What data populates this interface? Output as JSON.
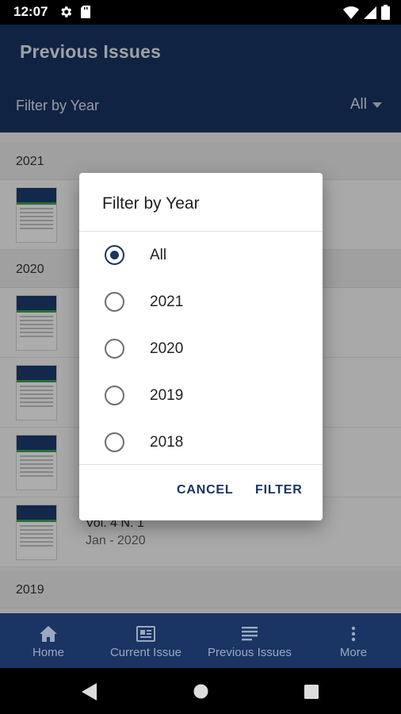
{
  "status_bar": {
    "time": "12:07",
    "left_icons": [
      "gear-icon",
      "sd-card-icon"
    ],
    "right_icons": [
      "wifi-icon",
      "cell-signal-icon",
      "battery-icon"
    ]
  },
  "app_bar": {
    "title": "Previous Issues",
    "filter_label": "Filter by Year",
    "filter_value": "All"
  },
  "sections": [
    {
      "year": "2021",
      "issues": [
        {
          "vol": "",
          "date": ""
        }
      ]
    },
    {
      "year": "2020",
      "issues": [
        {
          "vol": "",
          "date": ""
        },
        {
          "vol": "",
          "date": ""
        },
        {
          "vol": "",
          "date": ""
        },
        {
          "vol": "Vol. 4 N. 1",
          "date": "Jan - 2020"
        }
      ]
    },
    {
      "year": "2019",
      "issues": []
    }
  ],
  "dialog": {
    "title": "Filter by Year",
    "options": [
      {
        "label": "All",
        "selected": true
      },
      {
        "label": "2021",
        "selected": false
      },
      {
        "label": "2020",
        "selected": false
      },
      {
        "label": "2019",
        "selected": false
      },
      {
        "label": "2018",
        "selected": false
      }
    ],
    "cancel_label": "CANCEL",
    "filter_label": "FILTER"
  },
  "bottom_nav": [
    {
      "label": "Home",
      "icon": "home-icon"
    },
    {
      "label": "Current Issue",
      "icon": "newspaper-icon"
    },
    {
      "label": "Previous Issues",
      "icon": "list-icon"
    },
    {
      "label": "More",
      "icon": "more-vertical-icon"
    }
  ],
  "system_nav": [
    "back-icon",
    "home-circle-icon",
    "recents-icon"
  ],
  "colors": {
    "primary": "#1a3463",
    "nav_inactive": "#9aa8c0"
  }
}
